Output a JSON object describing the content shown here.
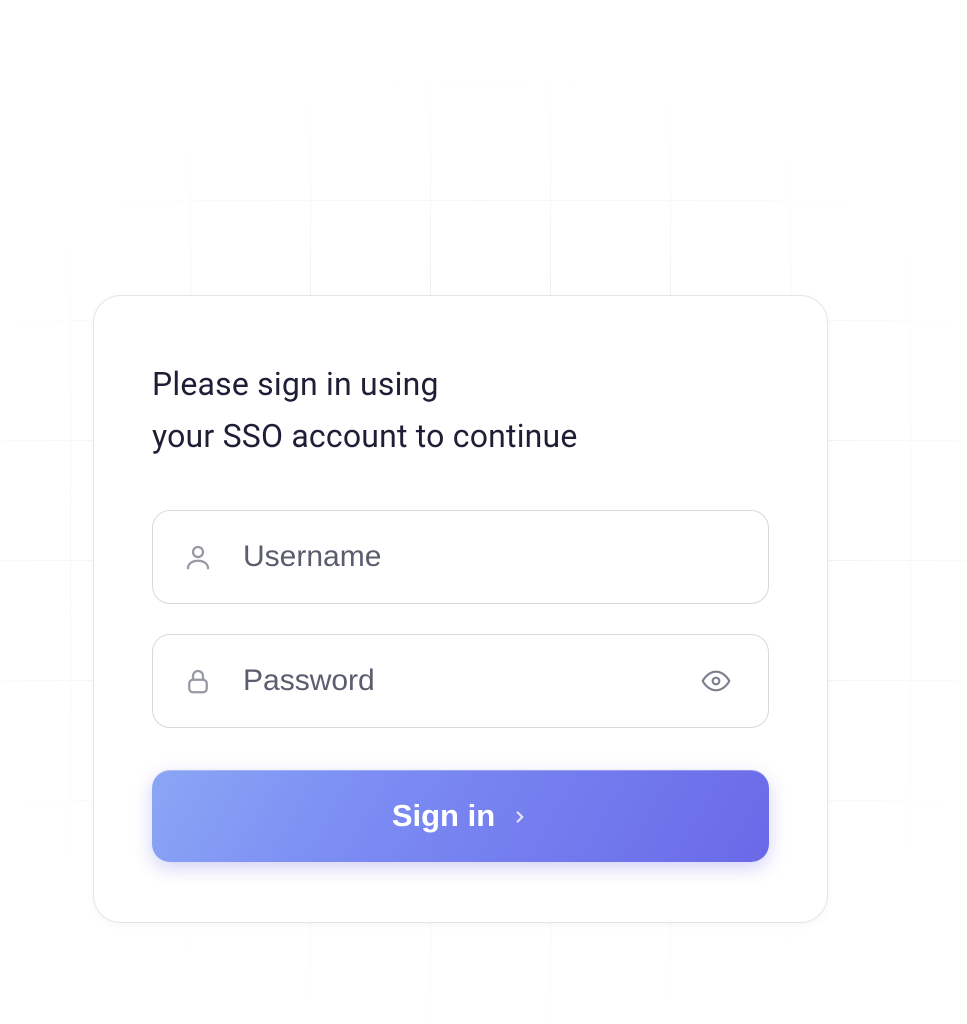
{
  "login": {
    "heading_line1": "Please sign in using",
    "heading_line2": "your SSO account to continue",
    "username_placeholder": "Username",
    "password_placeholder": "Password",
    "signin_label": "Sign in"
  }
}
